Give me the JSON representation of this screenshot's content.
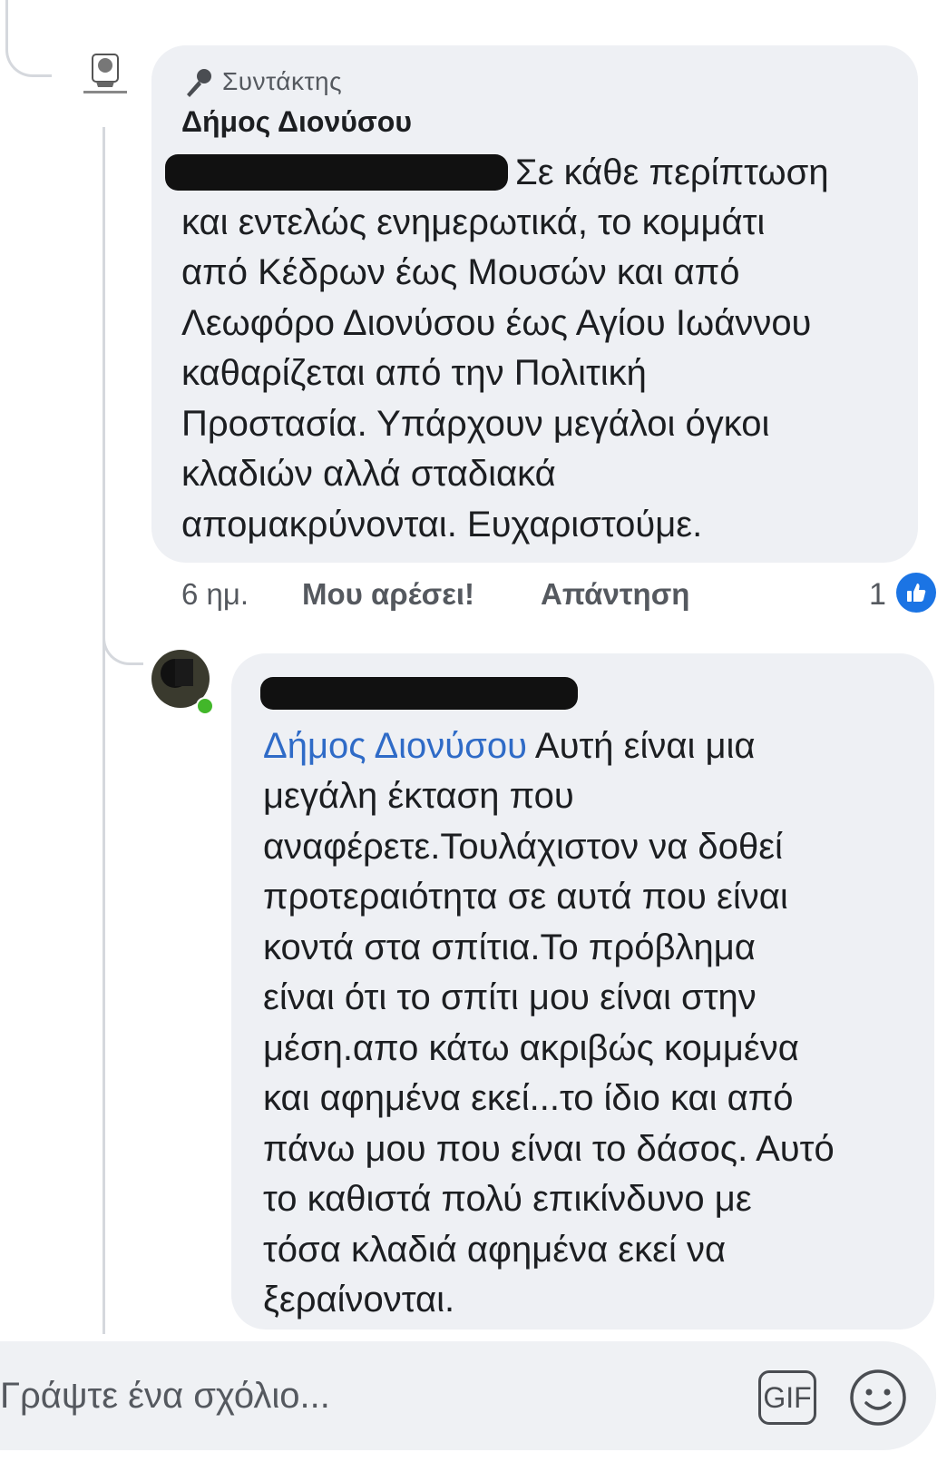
{
  "comment": {
    "editor_label": "Συντάκτης",
    "author": "Δήμος Διονύσου",
    "lines": [
      "Σε κάθε περίπτωση",
      "και εντελώς ενημερωτικά, το κομμάτι",
      "από Κέδρων έως Μουσών και από",
      "Λεωφόρο Διονύσου έως Αγίου Ιωάννου",
      "καθαρίζεται από την Πολιτική",
      "Προστασία. Υπάρχουν μεγάλοι όγκοι",
      "κλαδιών αλλά σταδιακά",
      "απομακρύνονται. Ευχαριστούμε."
    ],
    "time": "6 ημ.",
    "like_label": "Μου αρέσει!",
    "reply_label": "Απάντηση",
    "like_count": "1"
  },
  "reply": {
    "mention": "Δήμος Διονύσου",
    "lines": [
      " Αυτή είναι μια",
      "μεγάλη έκταση που",
      "αναφέρετε.Τουλάχιστον να δοθεί",
      "προτεραιότητα σε αυτά που είναι",
      "κοντά στα σπίτια.Το πρόβλημα",
      "είναι ότι το σπίτι μου είναι στην",
      "μέση.απο κάτω ακριβώς κομμένα",
      "και αφημένα εκεί...το ίδιο και από",
      "πάνω μου που είναι το δάσος. Αυτό",
      "το καθιστά πολύ επικίνδυνο με",
      "τόσα κλαδιά αφημένα εκεί να",
      "ξεραίνονται."
    ]
  },
  "composer": {
    "placeholder": "Γράψτε ένα σχόλιο...",
    "gif_label": "GIF"
  },
  "colors": {
    "bubble": "#eef0f4",
    "mention": "#2f6bc7",
    "like_badge": "#1b74e4",
    "online_dot": "#42b72a"
  }
}
